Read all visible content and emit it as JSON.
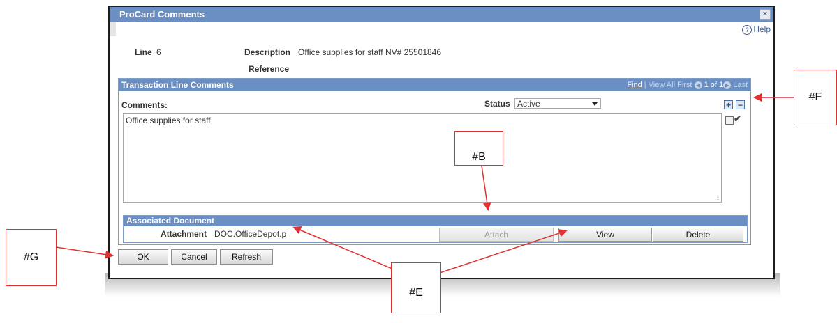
{
  "dialog": {
    "title": "ProCard Comments",
    "close_glyph": "×",
    "help_label": "Help",
    "help_glyph": "?"
  },
  "fields": {
    "line_label": "Line",
    "line_value": "6",
    "description_label": "Description",
    "description_value": "Office supplies for staff NV# 25501846",
    "reference_label": "Reference"
  },
  "comments_group": {
    "title": "Transaction Line Comments",
    "nav_find": "Find",
    "nav_sep": "|",
    "nav_view_all": "View All",
    "nav_first": "First",
    "nav_count": "1 of 1",
    "nav_last": "Last",
    "comments_label": "Comments:",
    "status_label": "Status",
    "status_value": "Active",
    "add_glyph": "+",
    "remove_glyph": "−",
    "comment_text": "Office supplies for staff"
  },
  "associated_document": {
    "title": "Associated Document",
    "attachment_label": "Attachment",
    "attachment_value": "DOC.OfficeDepot.p",
    "attach_button": "Attach",
    "view_button": "View",
    "delete_button": "Delete"
  },
  "footer": {
    "ok_button": "OK",
    "cancel_button": "Cancel",
    "refresh_button": "Refresh"
  },
  "callouts": {
    "b": "#B",
    "e": "#E",
    "f": "#F",
    "g": "#G"
  },
  "colors": {
    "header_blue": "#6b8fc3",
    "callout_red": "#e23030"
  }
}
